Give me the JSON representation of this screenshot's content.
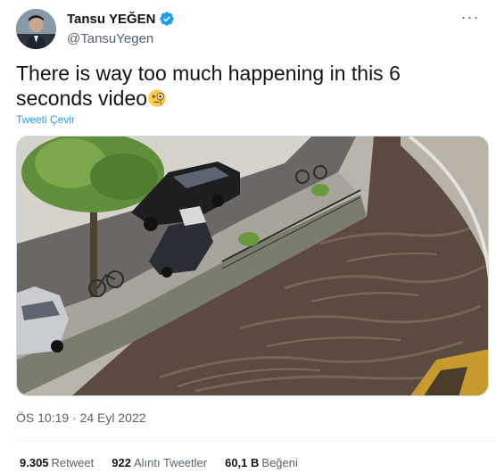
{
  "author": {
    "display_name": "Tansu YEĞEN",
    "handle": "@TansuYegen",
    "verified": true
  },
  "more_glyph": "···",
  "tweet": {
    "text": "There is way too much happening in this 6 seconds video",
    "emoji": "face-with-monocle",
    "translate_label": "Tweeti Çevir"
  },
  "media": {
    "kind": "video",
    "scene": "canal-street-with-cars"
  },
  "timestamp": "ÖS 10:19 · 24 Eyl 2022",
  "stats": [
    {
      "value": "9.305",
      "label": "Retweet"
    },
    {
      "value": "922",
      "label": "Alıntı Tweetler"
    },
    {
      "value": "60,1 B",
      "label": "Beğeni"
    }
  ],
  "colors": {
    "accent": "#1d9bf0",
    "secondary_text": "#536471",
    "water": "#5b4a3f"
  }
}
